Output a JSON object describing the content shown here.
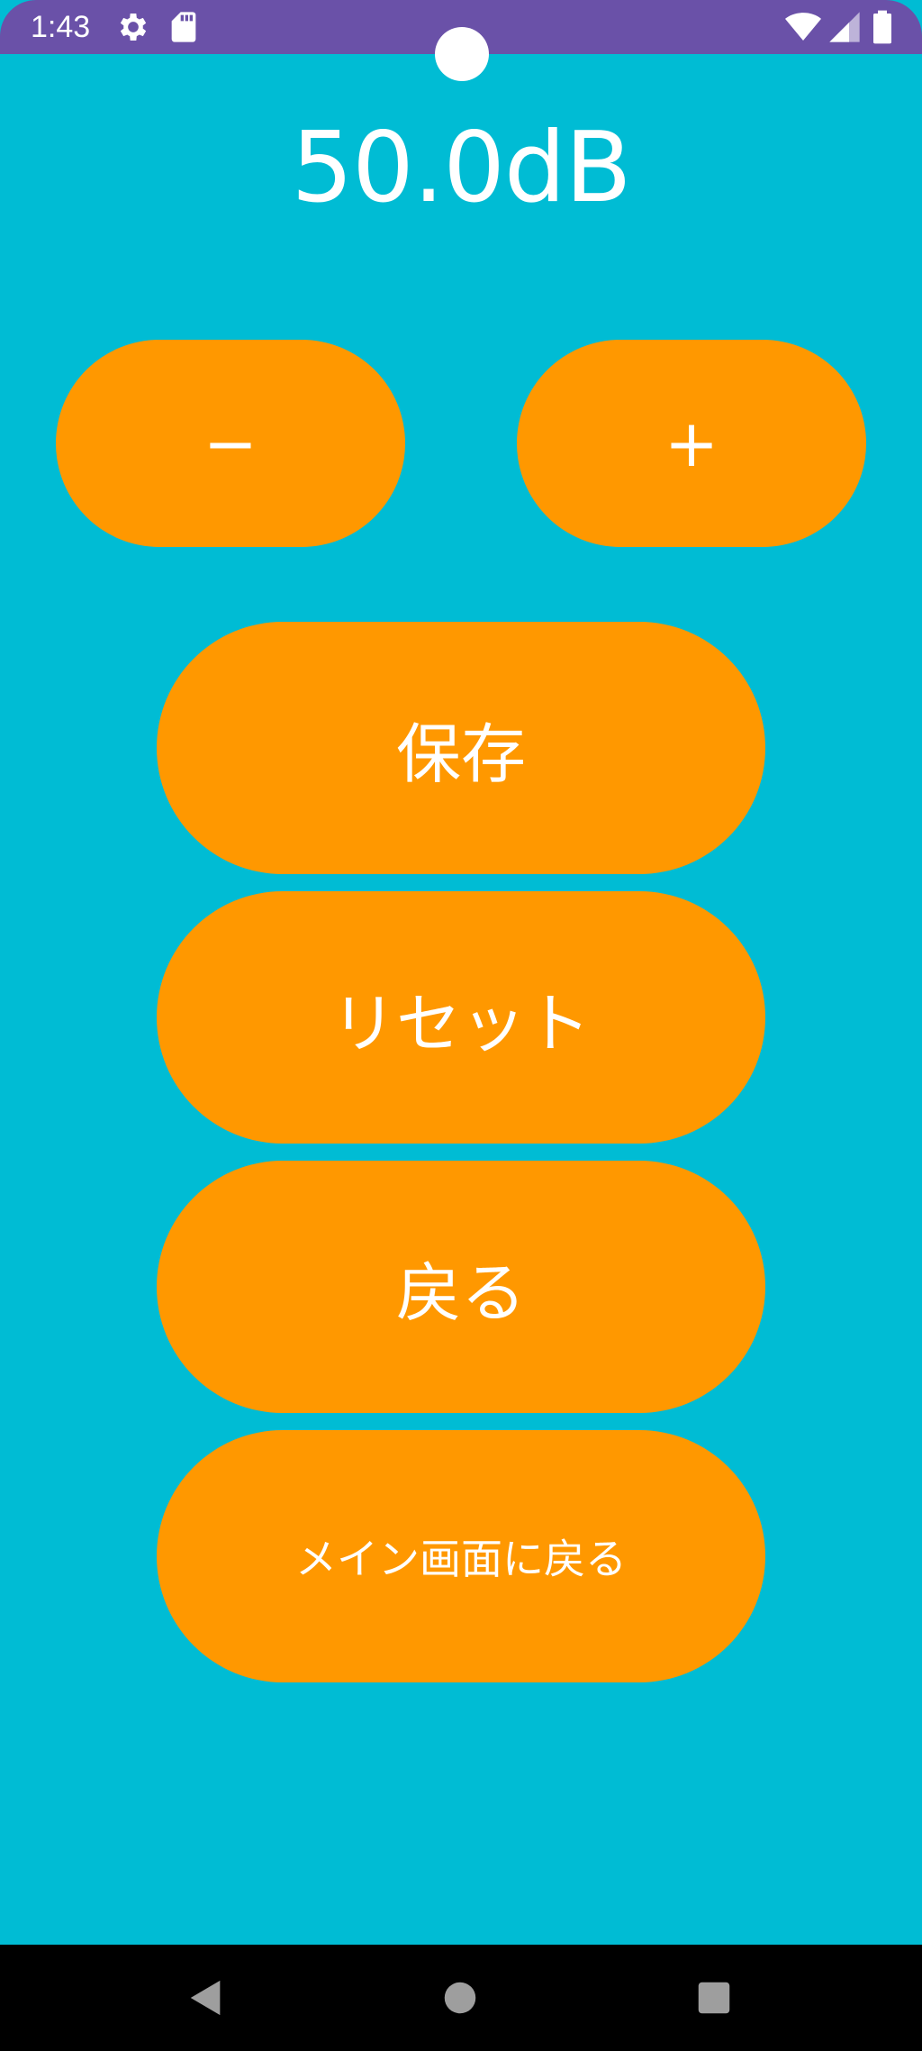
{
  "status_bar": {
    "time": "1:43",
    "icons": [
      "gear-icon",
      "sd-card-icon",
      "wifi-icon",
      "signal-icon",
      "battery-icon"
    ]
  },
  "meter": {
    "value": "50.0dB"
  },
  "buttons": {
    "minus": "−",
    "plus": "+",
    "save": "保存",
    "reset": "リセット",
    "back": "戻る",
    "main_back": "メイン画面に戻る"
  },
  "nav": {
    "icons": [
      "back-triangle-icon",
      "home-circle-icon",
      "recents-square-icon"
    ]
  },
  "colors": {
    "background": "#00BCD4",
    "button": "#FF9800",
    "status_bar": "#6A51A8",
    "nav_bar": "#000000",
    "text": "#FFFFFF"
  }
}
